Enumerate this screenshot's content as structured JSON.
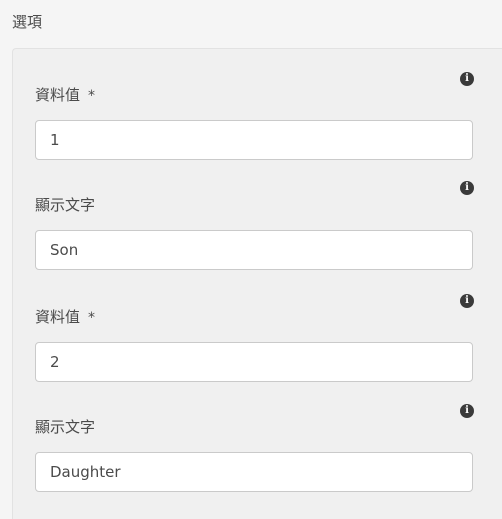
{
  "section": {
    "title": "選項"
  },
  "options": [
    {
      "value_label": "資料值",
      "required_mark": "*",
      "value": "1",
      "text_label": "顯示文字",
      "text": "Son"
    },
    {
      "value_label": "資料值",
      "required_mark": "*",
      "value": "2",
      "text_label": "顯示文字",
      "text": "Daughter"
    }
  ],
  "icons": {
    "info": "info-icon"
  },
  "colors": {
    "page_background": "#f5f5f5",
    "panel_background": "#f0f0f0",
    "input_border": "#cacaca",
    "icon": "#3a3a3a",
    "text": "#4b4b4b"
  }
}
